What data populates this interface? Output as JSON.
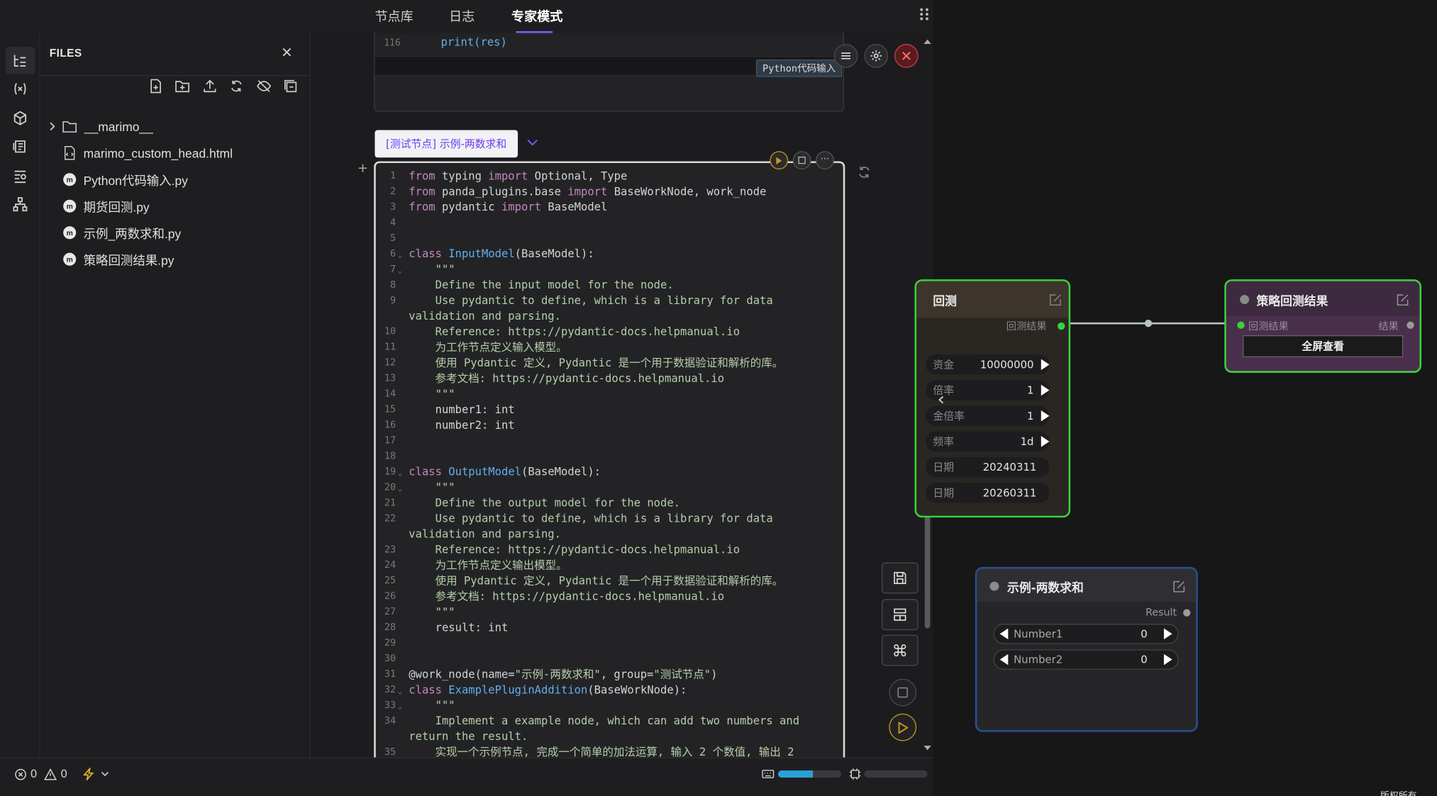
{
  "top_tabs": [
    "节点库",
    "日志",
    "专家模式"
  ],
  "active_tab": "专家模式",
  "files_panel": {
    "title": "FILES",
    "tree": [
      {
        "name": "__marimo__",
        "type": "folder"
      },
      {
        "name": "marimo_custom_head.html",
        "type": "html"
      },
      {
        "name": "Python代码输入.py",
        "type": "marimo"
      },
      {
        "name": "期货回测.py",
        "type": "marimo"
      },
      {
        "name": "示例_两数求和.py",
        "type": "marimo"
      },
      {
        "name": "策略回测结果.py",
        "type": "marimo"
      }
    ]
  },
  "prev_cell": {
    "line_no": "116",
    "code": "print(res)",
    "badge": "Python代码输入"
  },
  "node_tag": "[测试节点] 示例-两数求和",
  "code_lines": [
    {
      "n": "1",
      "tokens": [
        [
          "kw",
          "from"
        ],
        [
          "plain",
          " typing "
        ],
        [
          "kw",
          "import"
        ],
        [
          "plain",
          " Optional, Type"
        ]
      ]
    },
    {
      "n": "2",
      "tokens": [
        [
          "kw",
          "from"
        ],
        [
          "plain",
          " panda_plugins.base "
        ],
        [
          "kw",
          "import"
        ],
        [
          "plain",
          " BaseWorkNode, work_node"
        ]
      ]
    },
    {
      "n": "3",
      "tokens": [
        [
          "kw",
          "from"
        ],
        [
          "plain",
          " pydantic "
        ],
        [
          "kw",
          "import"
        ],
        [
          "plain",
          " BaseModel"
        ]
      ]
    },
    {
      "n": "4",
      "tokens": []
    },
    {
      "n": "5",
      "tokens": []
    },
    {
      "n": "6",
      "fold": true,
      "tokens": [
        [
          "kw",
          "class"
        ],
        [
          "plain",
          " "
        ],
        [
          "cls",
          "InputModel"
        ],
        [
          "plain",
          "(BaseModel):"
        ]
      ]
    },
    {
      "n": "7",
      "fold": true,
      "tokens": [
        [
          "doc",
          "    \"\"\""
        ]
      ]
    },
    {
      "n": "8",
      "tokens": [
        [
          "doc",
          "    Define the input model for the node."
        ]
      ]
    },
    {
      "n": "9",
      "tokens": [
        [
          "doc",
          "    Use pydantic to define, which is a library for data"
        ]
      ]
    },
    {
      "n": "",
      "tokens": [
        [
          "doc",
          "validation and parsing."
        ]
      ]
    },
    {
      "n": "10",
      "tokens": [
        [
          "doc",
          "    Reference: https://pydantic-docs.helpmanual.io"
        ]
      ]
    },
    {
      "n": "11",
      "tokens": [
        [
          "doc",
          "    为工作节点定义输入模型。"
        ]
      ]
    },
    {
      "n": "12",
      "tokens": [
        [
          "doc",
          "    使用 Pydantic 定义, Pydantic 是一个用于数据验证和解析的库。"
        ]
      ]
    },
    {
      "n": "13",
      "tokens": [
        [
          "doc",
          "    参考文档: https://pydantic-docs.helpmanual.io"
        ]
      ]
    },
    {
      "n": "14",
      "tokens": [
        [
          "doc",
          "    \"\"\""
        ]
      ]
    },
    {
      "n": "15",
      "tokens": [
        [
          "plain",
          "    number1: int"
        ]
      ]
    },
    {
      "n": "16",
      "tokens": [
        [
          "plain",
          "    number2: int"
        ]
      ]
    },
    {
      "n": "17",
      "tokens": []
    },
    {
      "n": "18",
      "tokens": []
    },
    {
      "n": "19",
      "fold": true,
      "tokens": [
        [
          "kw",
          "class"
        ],
        [
          "plain",
          " "
        ],
        [
          "cls",
          "OutputModel"
        ],
        [
          "plain",
          "(BaseModel):"
        ]
      ]
    },
    {
      "n": "20",
      "fold": true,
      "tokens": [
        [
          "doc",
          "    \"\"\""
        ]
      ]
    },
    {
      "n": "21",
      "tokens": [
        [
          "doc",
          "    Define the output model for the node."
        ]
      ]
    },
    {
      "n": "22",
      "tokens": [
        [
          "doc",
          "    Use pydantic to define, which is a library for data"
        ]
      ]
    },
    {
      "n": "",
      "tokens": [
        [
          "doc",
          "validation and parsing."
        ]
      ]
    },
    {
      "n": "23",
      "tokens": [
        [
          "doc",
          "    Reference: https://pydantic-docs.helpmanual.io"
        ]
      ]
    },
    {
      "n": "24",
      "tokens": [
        [
          "doc",
          "    为工作节点定义输出模型。"
        ]
      ]
    },
    {
      "n": "25",
      "tokens": [
        [
          "doc",
          "    使用 Pydantic 定义, Pydantic 是一个用于数据验证和解析的库。"
        ]
      ]
    },
    {
      "n": "26",
      "tokens": [
        [
          "doc",
          "    参考文档: https://pydantic-docs.helpmanual.io"
        ]
      ]
    },
    {
      "n": "27",
      "tokens": [
        [
          "doc",
          "    \"\"\""
        ]
      ]
    },
    {
      "n": "28",
      "tokens": [
        [
          "plain",
          "    result: int"
        ]
      ]
    },
    {
      "n": "29",
      "tokens": []
    },
    {
      "n": "30",
      "tokens": []
    },
    {
      "n": "31",
      "tokens": [
        [
          "plain",
          "@work_node(name="
        ],
        [
          "str",
          "\"示例-两数求和\""
        ],
        [
          "plain",
          ", group="
        ],
        [
          "str",
          "\"测试节点\""
        ],
        [
          "plain",
          ")"
        ]
      ]
    },
    {
      "n": "32",
      "fold": true,
      "tokens": [
        [
          "kw",
          "class"
        ],
        [
          "plain",
          " "
        ],
        [
          "cls",
          "ExamplePluginAddition"
        ],
        [
          "plain",
          "(BaseWorkNode):"
        ]
      ]
    },
    {
      "n": "33",
      "fold": true,
      "tokens": [
        [
          "doc",
          "    \"\"\""
        ]
      ]
    },
    {
      "n": "34",
      "tokens": [
        [
          "doc",
          "    Implement a example node, which can add two numbers and"
        ]
      ]
    },
    {
      "n": "",
      "tokens": [
        [
          "doc",
          "return the result."
        ]
      ]
    },
    {
      "n": "35",
      "tokens": [
        [
          "doc",
          "    实现一个示例节点, 完成一个简单的加法运算, 输入 2 个数值, 输出 2"
        ]
      ]
    }
  ],
  "status": {
    "errors": "0",
    "warnings": "0",
    "progress": 0.55
  },
  "graph": {
    "backtest_node": {
      "title": "回测",
      "output_label": "回测结果",
      "fields": [
        {
          "label": "资金",
          "value": "10000000",
          "arrow": true
        },
        {
          "label": "倍率",
          "value": "1",
          "arrow": true
        },
        {
          "label": "金倍率",
          "value": "1",
          "arrow": true
        },
        {
          "label": "频率",
          "value": "1d",
          "arrow": true
        },
        {
          "label": "日期",
          "value": "20240311",
          "arrow": false
        },
        {
          "label": "日期",
          "value": "20260311",
          "arrow": false
        }
      ]
    },
    "result_node": {
      "title": "策略回测结果",
      "input_label": "回测结果",
      "output_label": "结果",
      "button": "全屏查看"
    },
    "sum_node": {
      "title": "示例-两数求和",
      "output_label": "Result",
      "fields": [
        {
          "label": "Number1",
          "value": "0"
        },
        {
          "label": "Number2",
          "value": "0"
        }
      ]
    },
    "corner_text": "版权所有"
  },
  "colors": {
    "accent": "#7b5cff",
    "node_selected": "#3ad13a",
    "node_blue": "#2b4f8f",
    "run": "#c79a1c"
  }
}
